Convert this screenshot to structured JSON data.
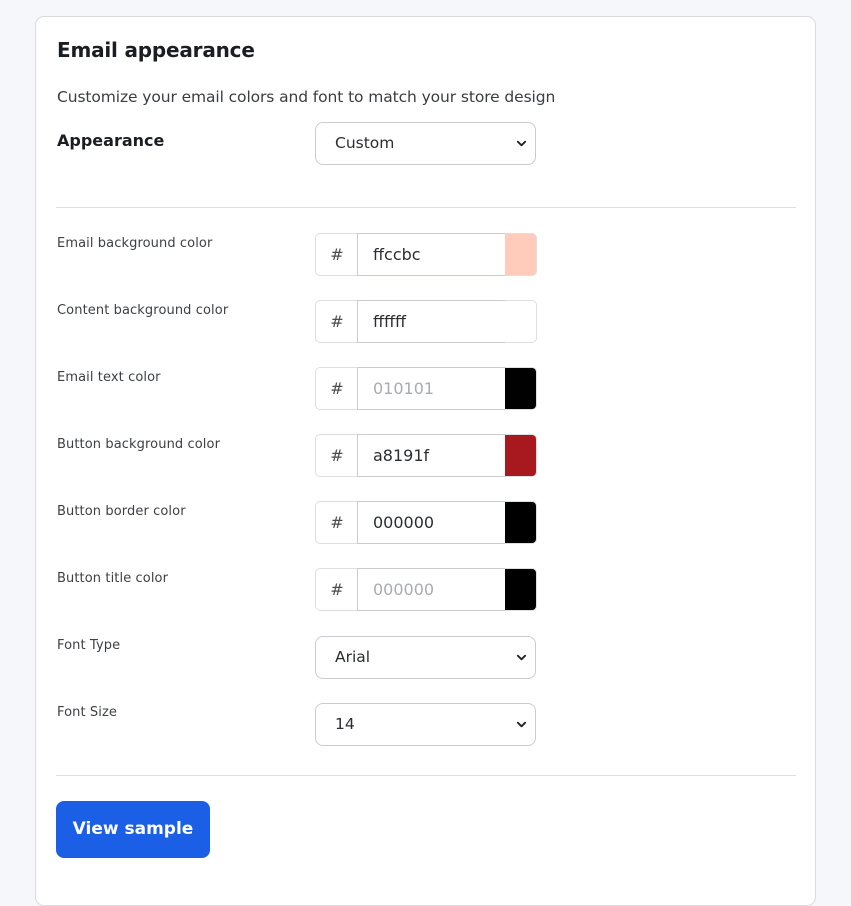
{
  "section": {
    "title": "Email appearance",
    "description": "Customize your email colors and font to match your store design"
  },
  "appearance": {
    "label": "Appearance",
    "selected": "Custom"
  },
  "colors": [
    {
      "label": "Email background color",
      "value": "ffccbc",
      "placeholder": "",
      "swatch": "#ffccbc"
    },
    {
      "label": "Content background color",
      "value": "ffffff",
      "placeholder": "",
      "swatch": "#ffffff"
    },
    {
      "label": "Email text color",
      "value": "",
      "placeholder": "010101",
      "swatch": "#010101"
    },
    {
      "label": "Button background color",
      "value": "a8191f",
      "placeholder": "",
      "swatch": "#a8191f"
    },
    {
      "label": "Button border color",
      "value": "000000",
      "placeholder": "",
      "swatch": "#000000"
    },
    {
      "label": "Button title color",
      "value": "",
      "placeholder": "000000",
      "swatch": "#000000"
    }
  ],
  "hash_symbol": "#",
  "font_type": {
    "label": "Font Type",
    "selected": "Arial"
  },
  "font_size": {
    "label": "Font Size",
    "selected": "14"
  },
  "actions": {
    "view_sample": "View sample"
  },
  "theme": {
    "accent": "#1a5fe6",
    "page_background": "#f6f7fb"
  }
}
